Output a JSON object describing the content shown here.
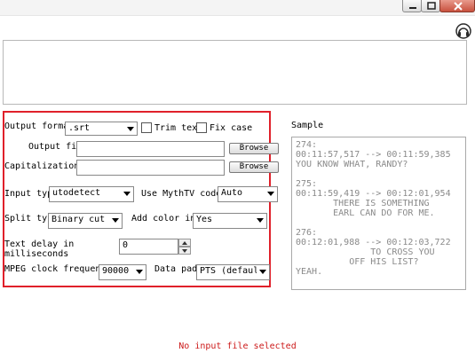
{
  "controls": {
    "output_format_label": "Output forma",
    "output_format_value": ".srt",
    "trim_text_label": "Trim tex",
    "fix_case_label": "Fix case",
    "output_file_label": "Output fil",
    "output_file_value": "",
    "capitalization_label": "Capitalization",
    "capitalization_value": "",
    "browse_label": "Browse",
    "input_type_label": "Input type",
    "input_type_value": "utodetect",
    "mythtv_code_label": "Use MythTV code",
    "mythtv_code_value": "Auto",
    "split_type_label": "Split typ",
    "split_type_value": "Binary cut",
    "add_color_label": "Add color in",
    "add_color_value": "Yes",
    "text_delay_label_1": "Text delay in",
    "text_delay_label_2": "milliseconds",
    "text_delay_value": "0",
    "mpeg_clock_label": "MPEG clock frequenc",
    "mpeg_clock_value": "90000",
    "data_pad_label": "Data pad",
    "data_pad_value": "PTS (defaul"
  },
  "sample": {
    "label": "Sample",
    "lines": [
      "274:",
      "00:11:57,517 --> 00:11:59,385",
      "YOU KNOW WHAT, RANDY?",
      "",
      "275:",
      "00:11:59,419 --> 00:12:01,954",
      "       THERE IS SOMETHING",
      "       EARL CAN DO FOR ME.",
      "",
      "276:",
      "00:12:01,988 --> 00:12:03,722",
      "              TO CROSS YOU",
      "          OFF HIS LIST?",
      "YEAH."
    ]
  },
  "status": {
    "message": "No input file selected"
  },
  "icons": {
    "help": "help-circle-icon",
    "minimize": "minimize-icon",
    "maximize": "maximize-icon",
    "close": "close-icon"
  },
  "colors": {
    "highlight_frame": "#e0202a",
    "status_text": "#cc1a1a",
    "sample_text": "#8a8a8a"
  }
}
